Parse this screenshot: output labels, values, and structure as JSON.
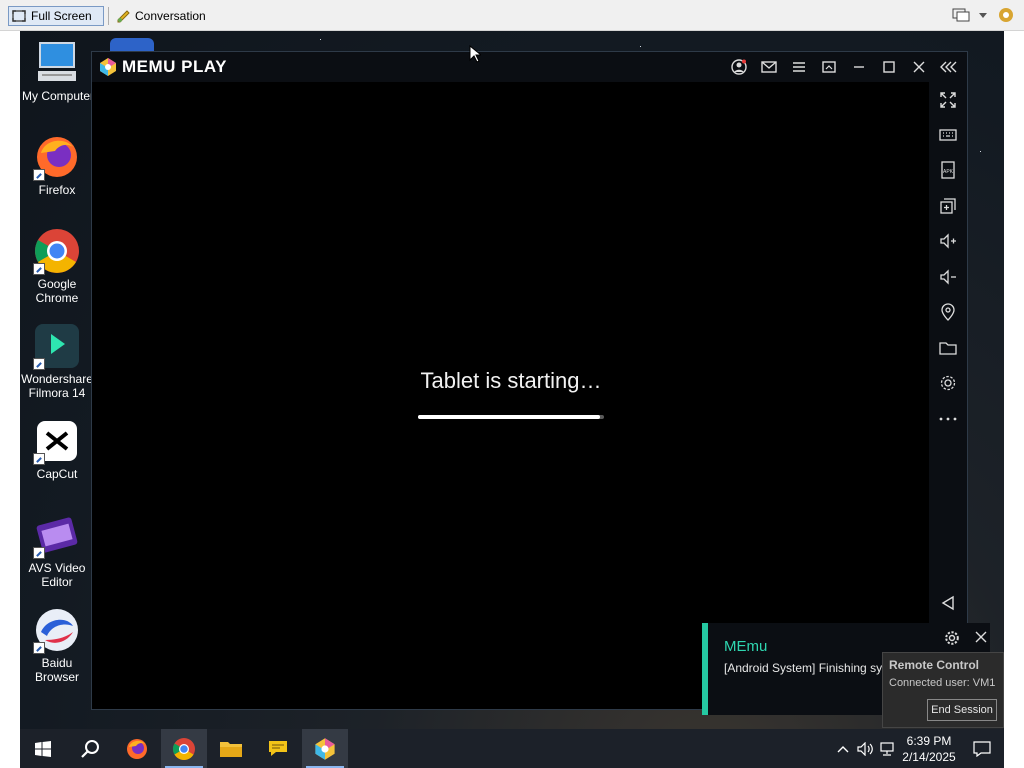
{
  "viewer": {
    "fullscreen_label": "Full Screen",
    "conversation_label": "Conversation"
  },
  "desktop_icons": [
    {
      "label": "My Computer",
      "icon": "computer-icon"
    },
    {
      "label": "Firefox",
      "icon": "firefox-icon"
    },
    {
      "label": "Google Chrome",
      "icon": "chrome-icon"
    },
    {
      "label": "Wondershare Filmora 14",
      "icon": "filmora-icon"
    },
    {
      "label": "CapCut",
      "icon": "capcut-icon"
    },
    {
      "label": "AVS Video Editor",
      "icon": "avs-video-icon"
    },
    {
      "label": "Baidu Browser",
      "icon": "baidu-browser-icon"
    }
  ],
  "memu": {
    "title": "MEMU PLAY",
    "status_text": "Tablet is starting…",
    "progress": 0.98,
    "accent": "#25c9a2"
  },
  "toast": {
    "app": "MEmu",
    "message": "[Android System] Finishing system update"
  },
  "remote": {
    "title": "Remote Control",
    "user": "Connected user: VM1",
    "end_label": "End Session"
  },
  "taskbar": {
    "time": "6:39 PM",
    "date": "2/14/2025"
  }
}
